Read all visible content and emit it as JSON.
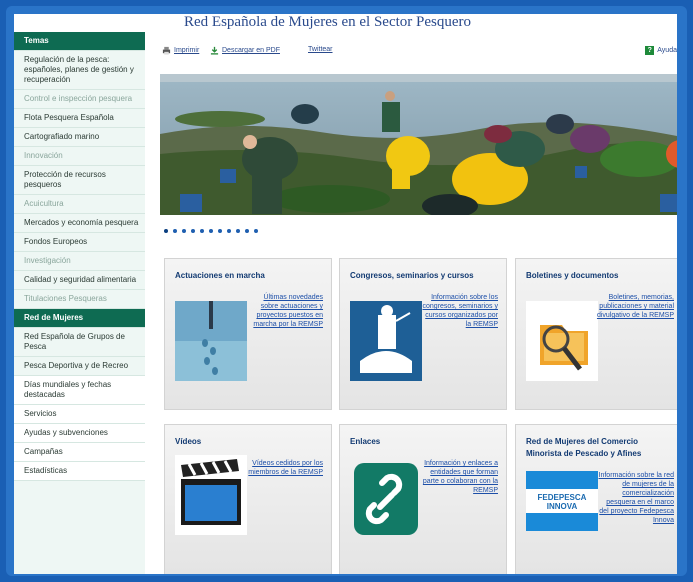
{
  "header": {
    "title": "Red Española de Mujeres en el Sector Pesquero",
    "print_label": "Imprimir",
    "download_pdf_label": "Descargar en PDF",
    "share_label": "Twittear",
    "help_label": "Ayuda"
  },
  "sidebar": {
    "items": [
      {
        "label": "Temas",
        "style": "head"
      },
      {
        "label": "Regulación de la pesca: españoles, planes de gestión y recuperación",
        "style": "normal"
      },
      {
        "label": "Control e inspección pesquera",
        "style": "sub"
      },
      {
        "label": "Flota Pesquera Española",
        "style": "normal"
      },
      {
        "label": "Cartografiado marino",
        "style": "normal"
      },
      {
        "label": "Innovación",
        "style": "sub"
      },
      {
        "label": "Protección de recursos pesqueros",
        "style": "normal"
      },
      {
        "label": "Acuicultura",
        "style": "sub"
      },
      {
        "label": "Mercados y economía pesquera",
        "style": "normal"
      },
      {
        "label": "Fondos Europeos",
        "style": "normal"
      },
      {
        "label": "Investigación",
        "style": "sub"
      },
      {
        "label": "Calidad y seguridad alimentaria",
        "style": "normal"
      },
      {
        "label": "Titulaciones Pesqueras",
        "style": "sub"
      },
      {
        "label": "Red de Mujeres",
        "style": "head"
      },
      {
        "label": "Red Española de Grupos de Pesca",
        "style": "normal"
      },
      {
        "label": "Pesca Deportiva y de Recreo",
        "style": "normal"
      },
      {
        "label": "Días mundiales y fechas destacadas",
        "style": "white"
      },
      {
        "label": "Servicios",
        "style": "white"
      },
      {
        "label": "Ayudas y subvenciones",
        "style": "white"
      },
      {
        "label": "Campañas",
        "style": "white"
      },
      {
        "label": "Estadísticas",
        "style": "white"
      }
    ]
  },
  "carousel": {
    "slide_count": 11,
    "active_index": 0
  },
  "cards": [
    {
      "title": "Actuaciones en marcha",
      "subtitle": "",
      "text": "Últimas novedades sobre actuaciones y proyectos puestos en marcha por la REMSP",
      "icon": "footprints-image"
    },
    {
      "title": "Congresos, seminarios y cursos",
      "subtitle": "",
      "text": "Información sobre los congresos, seminarios y cursos organizados por la REMSP",
      "icon": "conference-image"
    },
    {
      "title": "Boletines y documentos",
      "subtitle": "",
      "text": "Boletines, memorias, publicaciones y material divulgativo de la REMSP",
      "icon": "folder-magnifier-image"
    },
    {
      "title": "Vídeos",
      "subtitle": "",
      "text": "Vídeos cedidos por los miembros de la REMSP",
      "icon": "clapperboard-image"
    },
    {
      "title": "Enlaces",
      "subtitle": "",
      "text": "Información y enlaces a entidades que forman parte o colaboran con la REMSP",
      "icon": "link-image"
    },
    {
      "title": "Red de Mujeres del Comercio",
      "subtitle": "Minorista de Pescado y Afines",
      "text": "Información sobre la red de mujeres de la comercialización pesquera en el marco del proyecto Fedepesca Innova",
      "icon": "fedepesca-logo",
      "logo_text": "FEDEPESCA INNOVA"
    }
  ],
  "colors": {
    "frame": "#2a74c8",
    "sidebar_head": "#0e6b52",
    "sidebar_bg": "#eef7f4",
    "link": "#1d4fa8"
  }
}
